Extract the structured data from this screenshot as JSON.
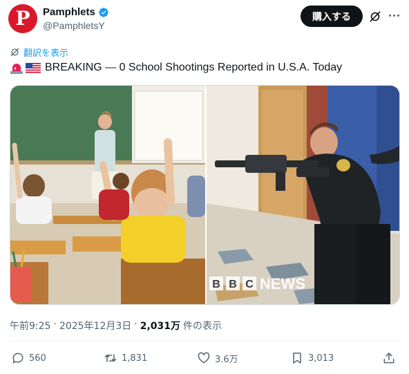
{
  "account": {
    "display_name": "Pamphlets",
    "handle": "@PamphletsY",
    "avatar_letter": "P",
    "avatar_color": "#d9182a",
    "verified_color": "#1d9bf0"
  },
  "header": {
    "buy_label": "購入する",
    "grok_icon": "grok-icon",
    "more_icon": "more-icon"
  },
  "translate": {
    "label": "翻訳を表示",
    "icon": "globe-icon"
  },
  "tweet": {
    "text": "BREAKING — 0 School Shootings Reported in U.S.A. Today",
    "emoji": [
      "rotating-light",
      "us-flag"
    ]
  },
  "media": {
    "left_image": "classroom with teacher and students raising hands",
    "right_image": "armed police officer in school hallway",
    "watermark": "BBC NEWS",
    "watermark_letters": [
      "B",
      "B",
      "C"
    ],
    "watermark_word": "NEWS"
  },
  "meta": {
    "time": "午前9:25",
    "date": "2025年12月3日",
    "views": "2,031万",
    "views_suffix": "件の表示"
  },
  "actions": {
    "replies": "560",
    "reposts": "1,831",
    "likes": "3.6万",
    "bookmarks": "3,013"
  },
  "colors": {
    "text": "#0f1419",
    "secondary": "#536471",
    "accent": "#1d9bf0",
    "button_bg": "#0f1419"
  }
}
